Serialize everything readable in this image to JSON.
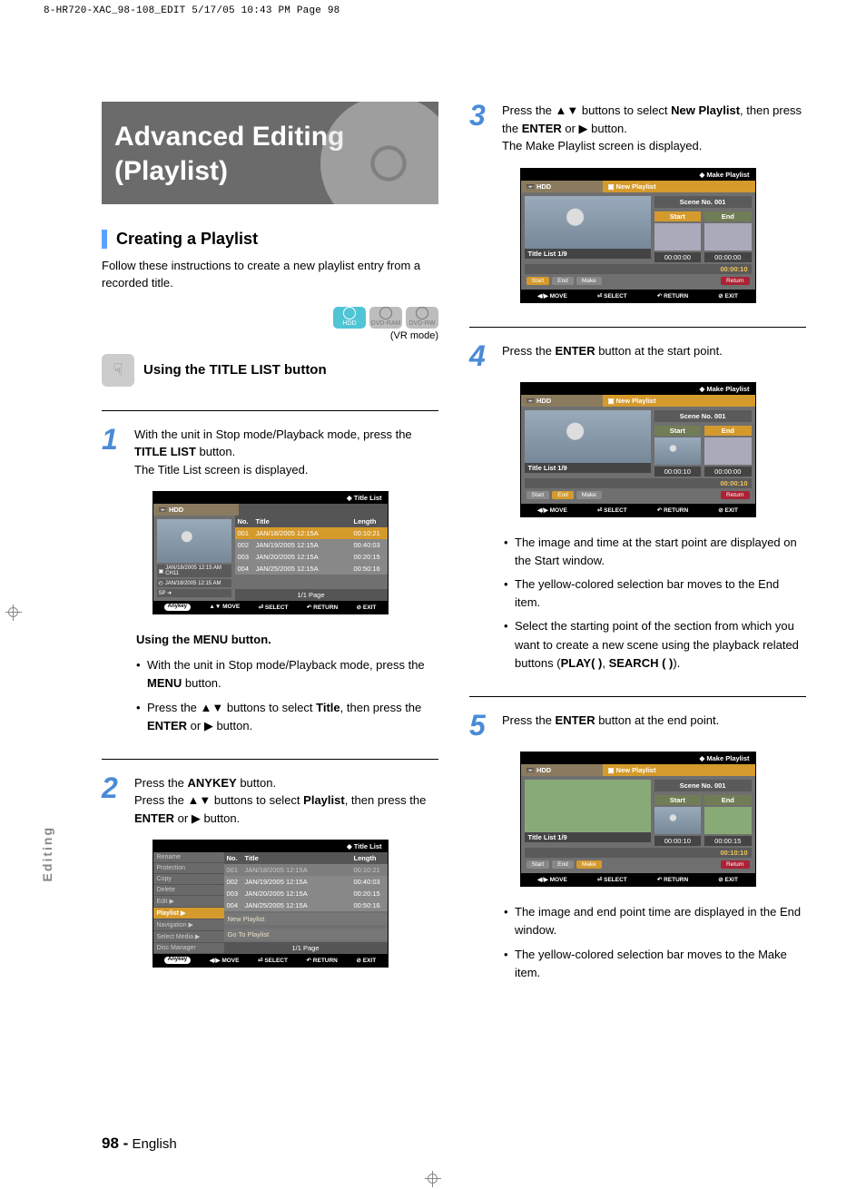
{
  "print_header": "8-HR720-XAC_98-108_EDIT  5/17/05  10:43 PM  Page 98",
  "banner_title": "Advanced Editing (Playlist)",
  "section_heading": "Creating a Playlist",
  "section_lead": "Follow these instructions to create a new playlist entry from a recorded title.",
  "media": {
    "hdd": "HDD",
    "ram": "DVD-RAM",
    "rw": "DVD-RW"
  },
  "vr_mode": "(VR mode)",
  "sub_heading": "Using the TITLE LIST button",
  "side_tab": "Editing",
  "page_footer": {
    "num": "98 -",
    "lang": "English"
  },
  "steps_left": {
    "s1": {
      "line1a": "With the unit in Stop mode/Playback mode, press the ",
      "line1b": "TITLE LIST",
      "line1c": " button.",
      "line2": "The Title List screen is displayed."
    },
    "menu_block": {
      "head": "Using the MENU button.",
      "b1a": "With the unit in Stop mode/Playback mode, press the ",
      "b1b": "MENU",
      "b1c": " button.",
      "b2a": "Press the ▲▼ buttons to select ",
      "b2b": "Title",
      "b2c": ", then press the ",
      "b2d": "ENTER",
      "b2e": " or ▶ button."
    },
    "s2": {
      "line1a": "Press the ",
      "line1b": "ANYKEY",
      "line1c": " button.",
      "line2a": "Press the ▲▼ buttons to select ",
      "line2b": "Playlist",
      "line2c": ", then press the ",
      "line2d": "ENTER",
      "line2e": " or ▶ button."
    }
  },
  "steps_right": {
    "s3": {
      "a": "Press the ▲▼ buttons to select ",
      "b": "New Playlist",
      "c": ", then press the ",
      "d": "ENTER",
      "e": " or ▶ button.",
      "f": "The Make Playlist screen is displayed."
    },
    "s4": {
      "a": "Press the ",
      "b": "ENTER",
      "c": " button at the start point."
    },
    "s4_notes": {
      "n1": "The image and time at the start point are displayed on the Start window.",
      "n2": "The yellow-colored selection bar moves to the End item.",
      "n3a": "Select the starting point of the section from which you want to create a new scene using the playback related  buttons (",
      "n3b": "PLAY( )",
      "n3c": ", ",
      "n3d": "SEARCH (   )",
      "n3e": ")."
    },
    "s5": {
      "a": "Press the ",
      "b": "ENTER",
      "c": " button at the end point."
    },
    "s5_notes": {
      "n1": "The image and end point time are displayed in the End window.",
      "n2": "The yellow-colored selection bar moves to the Make item."
    }
  },
  "ss_title_list": {
    "title": "Title List",
    "hdd": "HDD",
    "cols": {
      "no": "No.",
      "title": "Title",
      "len": "Length"
    },
    "rows": [
      {
        "no": "001",
        "title": "JAN/18/2005 12:15A",
        "len": "00:10:21",
        "hl": true
      },
      {
        "no": "002",
        "title": "JAN/19/2005 12:15A",
        "len": "00:40:03"
      },
      {
        "no": "003",
        "title": "JAN/20/2005 12:15A",
        "len": "00:20:15"
      },
      {
        "no": "004",
        "title": "JAN/25/2005 12:15A",
        "len": "00:50:16"
      }
    ],
    "meta1": "JAN/18/2005 12:15 AM CH11",
    "meta2": "JAN/18/2005 12:15 AM",
    "meta3": "SP ➜",
    "page": "1/1  Page",
    "footer": {
      "anykey": "Anykey",
      "move": "MOVE",
      "select": "SELECT",
      "return": "RETURN",
      "exit": "EXIT"
    },
    "footer_sym": {
      "move": "▲▼",
      "move2": "◀/▶",
      "select": "⏎",
      "return": "↶",
      "exit": "⊘"
    }
  },
  "ss_anykey": {
    "title": "Title List",
    "menu": [
      "Rename",
      "Protection",
      "Copy",
      "Delete",
      "Edit",
      "Playlist",
      "Navigation",
      "Select Media",
      "Disc Manager"
    ],
    "menu_sel": "Playlist",
    "submenu": [
      "New Playlist",
      "Go To Playlist"
    ],
    "page": "1/1  Page"
  },
  "ss_make": {
    "title": "Make Playlist",
    "hdd": "HDD",
    "new_pl": "New Playlist",
    "scene": "Scene No. 001",
    "start": "Start",
    "end": "End",
    "tl": "Title List 1/9",
    "btns": {
      "start": "Start",
      "end": "End",
      "make": "Make",
      "return": "Return"
    },
    "footer": {
      "move": "MOVE",
      "select": "SELECT",
      "return": "RETURN",
      "exit": "EXIT"
    },
    "footer_sym_move": "◀/▶"
  },
  "ss3": {
    "st": "00:00:00",
    "et": "00:00:00",
    "tot": "00:00:10"
  },
  "ss4": {
    "st": "00:00:10",
    "et": "00:00:00",
    "tot": "00:00:10"
  },
  "ss5": {
    "st": "00:00:10",
    "et": "00:00:15",
    "tot": "00:10:10"
  }
}
